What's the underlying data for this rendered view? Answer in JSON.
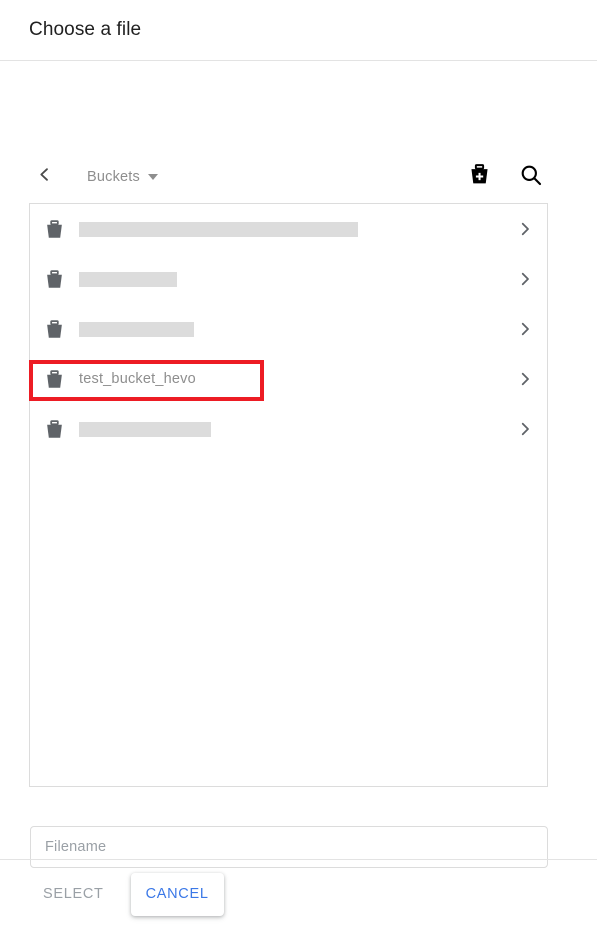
{
  "header": {
    "title": "Choose a file"
  },
  "toolbar": {
    "back_icon": "chevron-left-icon",
    "breadcrumb_label": "Buckets",
    "caret_icon": "chevron-down-icon",
    "new_bucket_icon": "bucket-add-icon",
    "search_icon": "search-icon"
  },
  "list": {
    "rows": [
      {
        "name": "",
        "redacted": true,
        "redact_width": 279,
        "chevron": "chevron-right-icon",
        "highlighted": false
      },
      {
        "name": "",
        "redacted": true,
        "redact_width": 98,
        "chevron": "chevron-right-icon",
        "highlighted": false
      },
      {
        "name": "",
        "redacted": true,
        "redact_width": 115,
        "chevron": "chevron-right-icon",
        "highlighted": false
      },
      {
        "name": "test_bucket_hevo",
        "redacted": false,
        "redact_width": 0,
        "chevron": "chevron-right-icon",
        "highlighted": true
      },
      {
        "name": "",
        "redacted": true,
        "redact_width": 132,
        "chevron": "chevron-right-icon",
        "highlighted": false
      }
    ],
    "row_icon": "bucket-icon"
  },
  "highlight": {
    "color": "#ed1c24",
    "target_row_index": 3
  },
  "filename": {
    "placeholder": "Filename",
    "value": ""
  },
  "footer": {
    "select_label": "SELECT",
    "select_disabled": true,
    "cancel_label": "CANCEL",
    "cancel_color": "#3b78e7"
  }
}
